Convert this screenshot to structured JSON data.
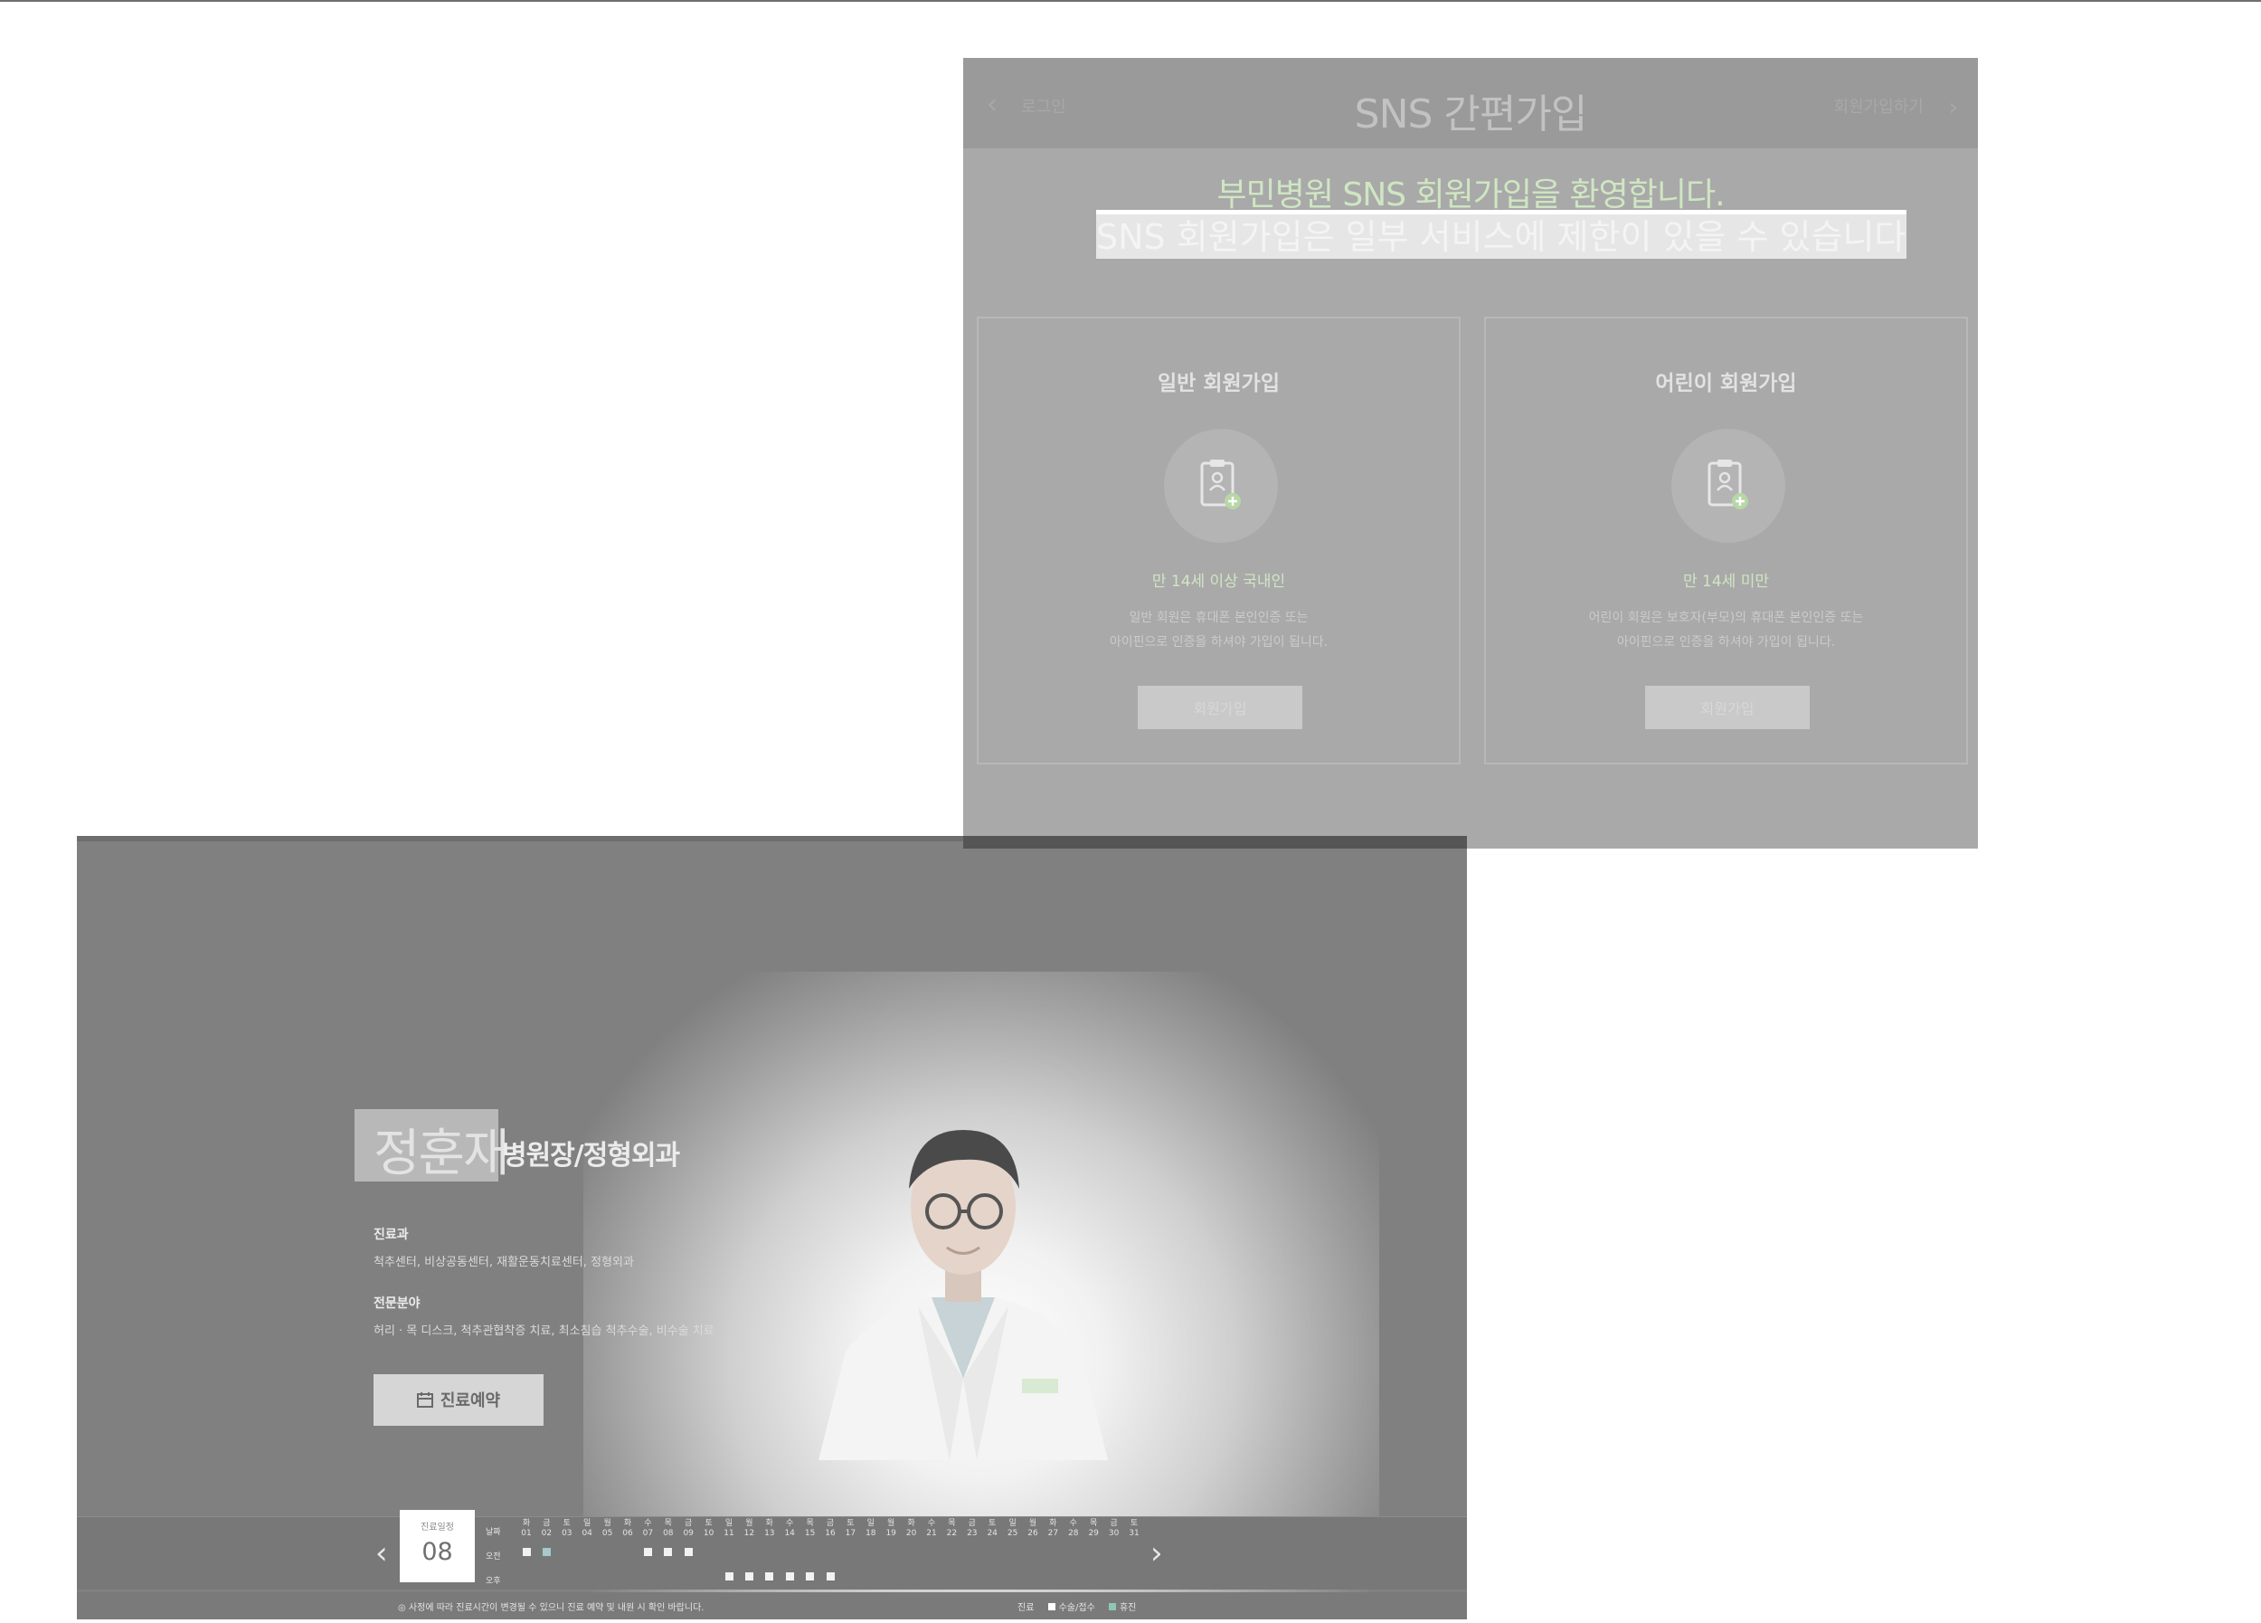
{
  "sns": {
    "back_label": "로그인",
    "title": "SNS 간편가입",
    "next_label": "회원가입하기",
    "welcome": "부민병원 SNS 회원가입을 환영합니다.",
    "notice": "SNS 회원가입은 일부 서비스에 제한이 있을 수 있습니다.",
    "cards": [
      {
        "title": "일반 회원가입",
        "age": "만 14세 이상 국내인",
        "desc_line1": "일반 회원은 휴대폰 본인인증 또는",
        "desc_line2": "아이핀으로 인증을 하셔야 가입이 됩니다.",
        "button": "회원가입"
      },
      {
        "title": "어린이 회원가입",
        "age": "만 14세 미만",
        "desc_line1": "어린이 회원은 보호자(부모)의 휴대폰 본인인증 또는",
        "desc_line2": "아이핀으로 인증을 하셔야 가입이 됩니다.",
        "button": "회원가입"
      }
    ]
  },
  "doctor": {
    "name": "정훈재",
    "title": "병원장/정형외과",
    "dept_label": "진료과",
    "dept_value": "척추센터, 비상공동센터, 재활운동치료센터, 정형외과",
    "specialty_label": "전문분야",
    "specialty_value": "허리 · 목 디스크, 척추관협착증 치료, 최소침습 척추수술, 비수술 치료",
    "book_button": "진료예약"
  },
  "schedule": {
    "date_label": "진료일정",
    "date_value": "08",
    "row_labels": [
      "날짜",
      "오전",
      "오후"
    ],
    "days": [
      {
        "w": "화",
        "d": "01"
      },
      {
        "w": "금",
        "d": "02"
      },
      {
        "w": "토",
        "d": "03"
      },
      {
        "w": "일",
        "d": "04"
      },
      {
        "w": "월",
        "d": "05"
      },
      {
        "w": "화",
        "d": "06"
      },
      {
        "w": "수",
        "d": "07"
      },
      {
        "w": "목",
        "d": "08"
      },
      {
        "w": "금",
        "d": "09"
      },
      {
        "w": "토",
        "d": "10"
      },
      {
        "w": "일",
        "d": "11"
      },
      {
        "w": "월",
        "d": "12"
      },
      {
        "w": "화",
        "d": "13"
      },
      {
        "w": "수",
        "d": "14"
      },
      {
        "w": "목",
        "d": "15"
      },
      {
        "w": "금",
        "d": "16"
      },
      {
        "w": "토",
        "d": "17"
      },
      {
        "w": "일",
        "d": "18"
      },
      {
        "w": "월",
        "d": "19"
      },
      {
        "w": "화",
        "d": "20"
      },
      {
        "w": "수",
        "d": "21"
      },
      {
        "w": "목",
        "d": "22"
      },
      {
        "w": "금",
        "d": "23"
      },
      {
        "w": "토",
        "d": "24"
      },
      {
        "w": "일",
        "d": "25"
      },
      {
        "w": "월",
        "d": "26"
      },
      {
        "w": "화",
        "d": "27"
      },
      {
        "w": "수",
        "d": "28"
      },
      {
        "w": "목",
        "d": "29"
      },
      {
        "w": "금",
        "d": "30"
      },
      {
        "w": "토",
        "d": "31"
      }
    ],
    "am_slots": [
      {
        "i": 0,
        "s": "clinic"
      },
      {
        "i": 1,
        "s": "special"
      },
      {
        "i": 6,
        "s": "clinic"
      },
      {
        "i": 7,
        "s": "clinic"
      },
      {
        "i": 8,
        "s": "clinic"
      }
    ],
    "pm_slots": [
      {
        "i": 10,
        "s": "clinic"
      },
      {
        "i": 11,
        "s": "clinic"
      },
      {
        "i": 12,
        "s": "clinic"
      },
      {
        "i": 13,
        "s": "clinic"
      },
      {
        "i": 14,
        "s": "clinic"
      },
      {
        "i": 15,
        "s": "clinic"
      }
    ],
    "footnote": "사정에 따라 진료시간이 변경될 수 있으니 진료 예약 및 내원 시 확인 바랍니다.",
    "legend_title": "진료",
    "legend_clinic": "수술/접수",
    "legend_special": "휴진"
  }
}
